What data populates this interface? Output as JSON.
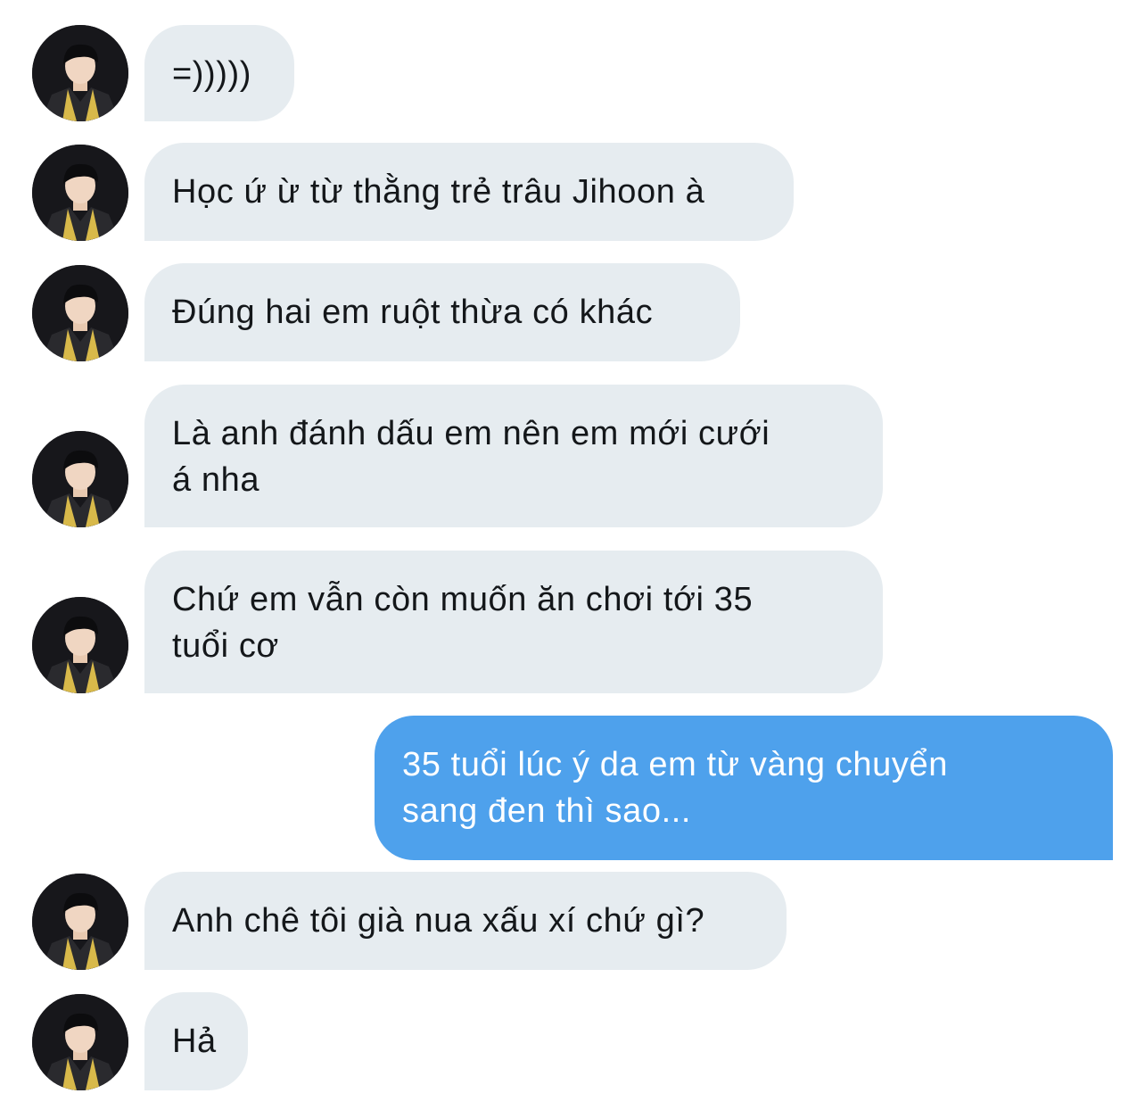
{
  "conversation": {
    "messages": [
      {
        "side": "received",
        "text": "=)))))"
      },
      {
        "side": "received",
        "text": "Học ứ ừ từ thằng trẻ trâu Jihoon à"
      },
      {
        "side": "received",
        "text": "Đúng hai em ruột thừa có khác"
      },
      {
        "side": "received",
        "text": "Là anh đánh dấu em nên em mới cưới\ná nha"
      },
      {
        "side": "received",
        "text": "Chứ em vẫn còn muốn ăn chơi tới 35\ntuổi cơ"
      },
      {
        "side": "sent",
        "text": "35 tuổi lúc ý da em từ vàng chuyển\nsang đen thì sao..."
      },
      {
        "side": "received",
        "text": "Anh chê tôi già nua xấu xí chứ gì?"
      },
      {
        "side": "received",
        "text": "Hả"
      }
    ]
  },
  "colors": {
    "received_bubble": "#e6ecf0",
    "sent_bubble": "#4ea1ec",
    "received_text": "#14171a",
    "sent_text": "#ffffff",
    "background": "#ffffff"
  },
  "icons": {
    "avatar": "user-avatar-photo"
  }
}
